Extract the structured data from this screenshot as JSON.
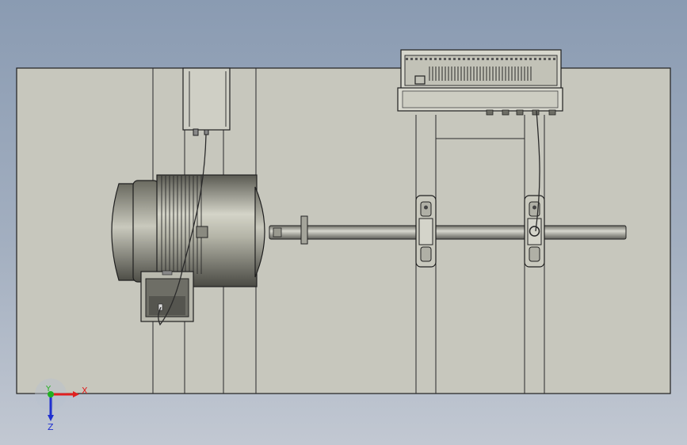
{
  "scene": {
    "view": "top",
    "background_top": "#8a9bb2",
    "background_bottom": "#c2c8d2",
    "base_plate_color": "#c7c7bd",
    "line_color": "#1f1f1f"
  },
  "triad": {
    "x_label": "X",
    "y_label": "Y",
    "z_label": "Z",
    "x_color": "#e02020",
    "y_color": "#20b020",
    "z_color": "#2030d0"
  },
  "components": {
    "motor": "motor",
    "terminal_box": "terminal-box",
    "shaft": "shaft",
    "pillow_block_left": "pillow-block-bearing",
    "pillow_block_right": "pillow-block-bearing",
    "controller": "controller-unit",
    "sensor_bracket": "sensor-bracket",
    "signal_cables": "signal-cable"
  }
}
